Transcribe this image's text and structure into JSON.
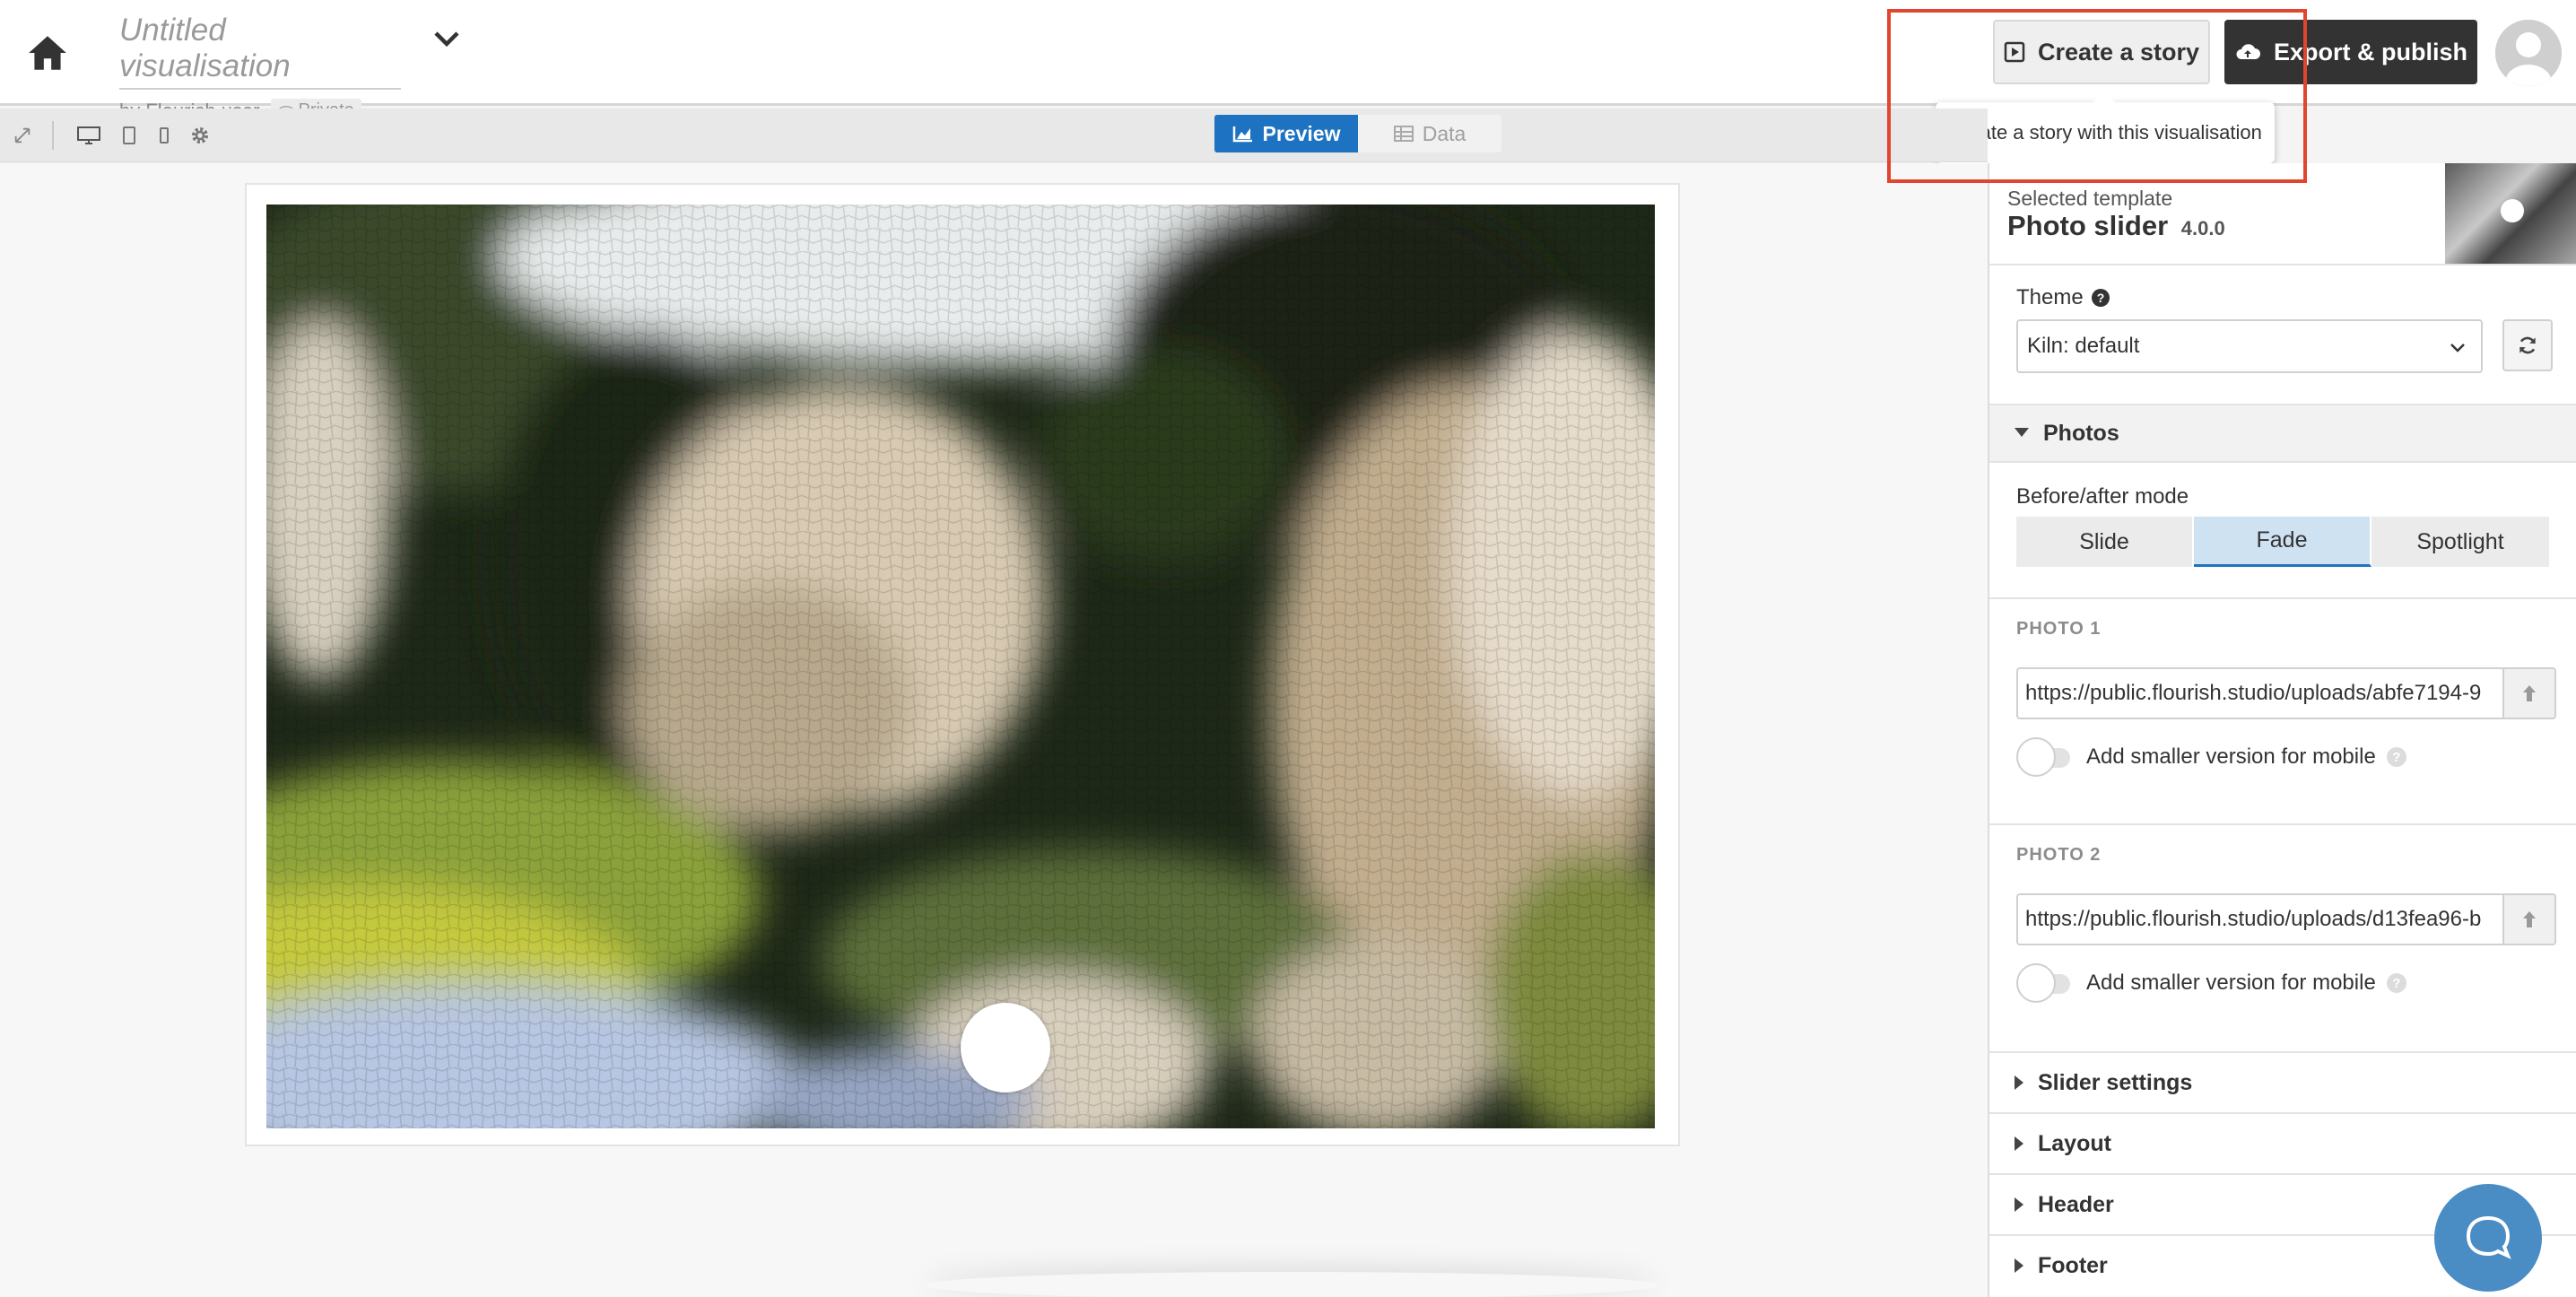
{
  "header": {
    "title": "Untitled visualisation",
    "byline": "by Flourish user",
    "privacy": "Private",
    "create_story_label": "Create a story",
    "export_label": "Export & publish",
    "tooltip": "Create a story with this visualisation"
  },
  "toolbar": {
    "preview_label": "Preview",
    "data_label": "Data",
    "active_tab": "Preview"
  },
  "template": {
    "label": "Selected template",
    "name": "Photo slider",
    "version": "4.0.0"
  },
  "theme": {
    "label": "Theme",
    "value": "Kiln: default"
  },
  "photos_section": {
    "title": "Photos",
    "mode_label": "Before/after mode",
    "modes": [
      "Slide",
      "Fade",
      "Spotlight"
    ],
    "active_mode": "Fade",
    "photo1": {
      "title": "PHOTO 1",
      "url": "https://public.flourish.studio/uploads/abfe7194-9",
      "mobile_label": "Add smaller version for mobile",
      "mobile_enabled": false
    },
    "photo2": {
      "title": "PHOTO 2",
      "url": "https://public.flourish.studio/uploads/d13fea96-b",
      "mobile_label": "Add smaller version for mobile",
      "mobile_enabled": false
    }
  },
  "collapsed_sections": {
    "slider": "Slider settings",
    "layout": "Layout",
    "header": "Header",
    "footer": "Footer"
  },
  "colors": {
    "accent": "#1d73c2",
    "dark_button": "#333333",
    "highlight": "#e2452f",
    "chat": "#4a8cc4"
  },
  "icons": [
    "home-icon",
    "chevron-down-icon",
    "eye-icon",
    "play-square-icon",
    "cloud-upload-icon",
    "expand-icon",
    "desktop-icon",
    "tablet-icon",
    "mobile-icon",
    "gear-icon",
    "chart-icon",
    "table-icon",
    "question-icon",
    "refresh-icon",
    "caret-down-icon",
    "caret-right-icon",
    "upload-arrow-icon",
    "chat-icon"
  ]
}
